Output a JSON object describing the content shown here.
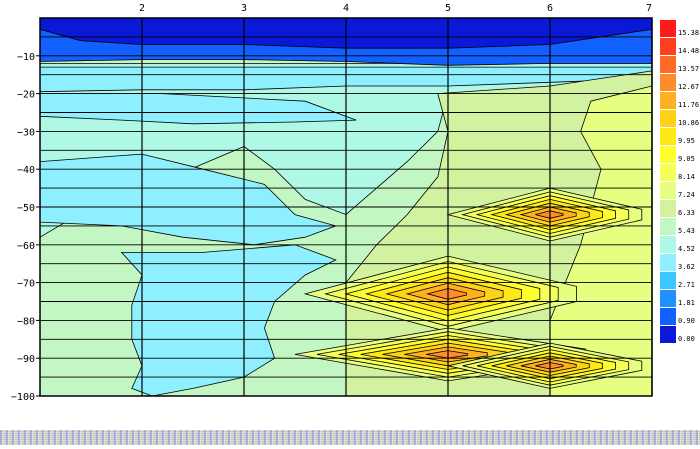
{
  "chart_data": {
    "type": "contour",
    "x_ticks": [
      2,
      3,
      4,
      5,
      6,
      7
    ],
    "y_ticks": [
      -10,
      -20,
      -30,
      -40,
      -50,
      -60,
      -70,
      -80,
      -90,
      -100
    ],
    "x_range": [
      1,
      7
    ],
    "y_range": [
      -100,
      0
    ],
    "grid": true,
    "legend_position": "right",
    "colorbar": {
      "labels": [
        "15.38",
        "14.48",
        "13.57",
        "12.67",
        "11.76",
        "10.86",
        "9.95",
        "9.05",
        "8.14",
        "7.24",
        "6.33",
        "5.43",
        "4.52",
        "3.62",
        "2.71",
        "1.81",
        "0.90",
        "0.00"
      ],
      "colors": [
        "#ff1a1a",
        "#ff4020",
        "#ff6a2a",
        "#ff8c2a",
        "#ffb020",
        "#ffd21a",
        "#ffe818",
        "#ffff30",
        "#f6ff5a",
        "#e6ff80",
        "#d2f2a0",
        "#c2f6c2",
        "#b0f8e6",
        "#8ef0ff",
        "#3ac8ff",
        "#1e90ff",
        "#1260ff",
        "#0a18d8"
      ]
    }
  }
}
